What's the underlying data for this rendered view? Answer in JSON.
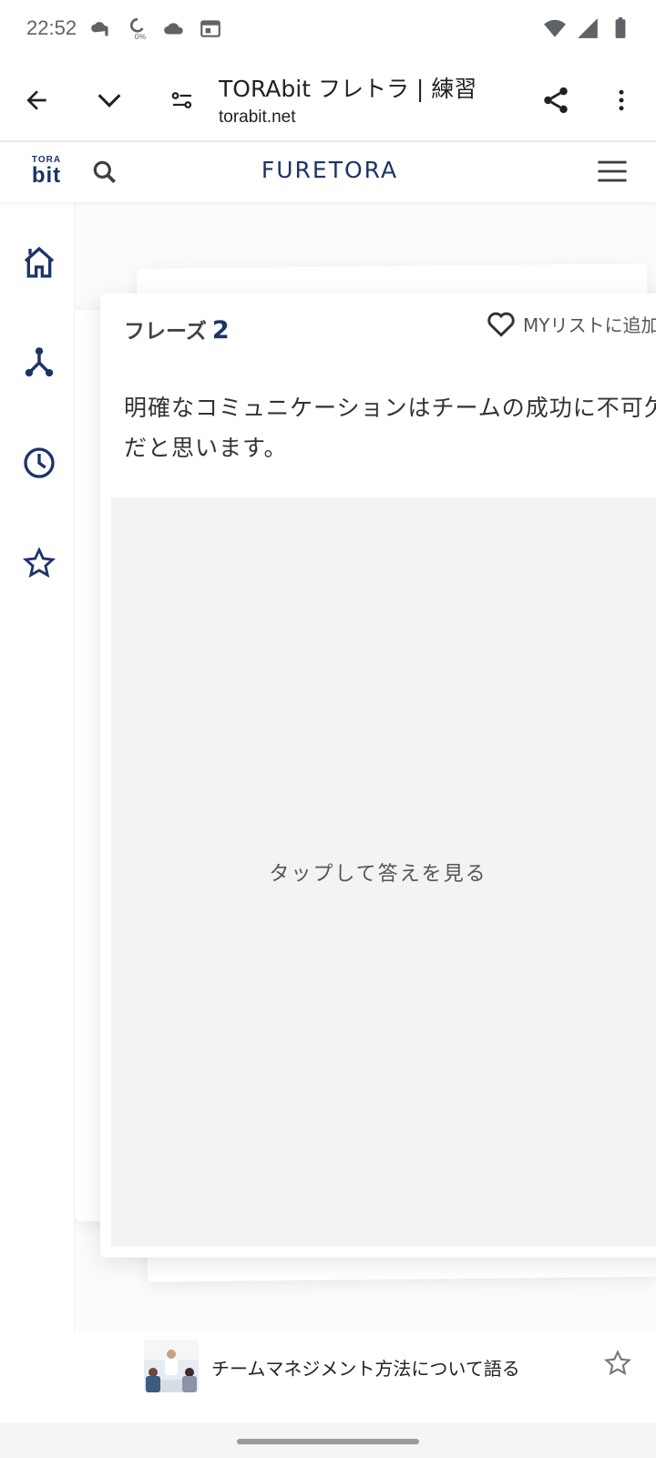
{
  "status_bar": {
    "time": "22:52",
    "icons_left": [
      "weather-alert-icon",
      "data-saver-icon",
      "cloud-icon",
      "calendar-icon"
    ],
    "icons_right": [
      "wifi-icon",
      "signal-icon",
      "battery-icon"
    ]
  },
  "browser": {
    "tab_title": "TORAbit フレトラ | 練習",
    "url": "torabit.net",
    "buttons": [
      "back-icon",
      "chevron-down-icon",
      "site-settings-icon",
      "share-icon",
      "more-vert-icon"
    ]
  },
  "site_header": {
    "logo_top": "TORA",
    "logo_bottom": "bit",
    "title": "FURETORA"
  },
  "left_rail": {
    "items": [
      "home-icon",
      "hierarchy-icon",
      "history-icon",
      "star-icon"
    ]
  },
  "card": {
    "phrase_label": "フレーズ",
    "phrase_number": "2",
    "mylist_label": "MYリストに追加",
    "phrase_text": "明確なコミュニケーションはチームの成功に不可欠だと思います。",
    "answer_prompt": "タップして答えを見る"
  },
  "related": {
    "title": "チームマネジメント方法について語る"
  },
  "colors": {
    "brand": "#1c3467",
    "answer_bg": "#f3f3f3",
    "gesture_bg": "#f3f6f4"
  }
}
